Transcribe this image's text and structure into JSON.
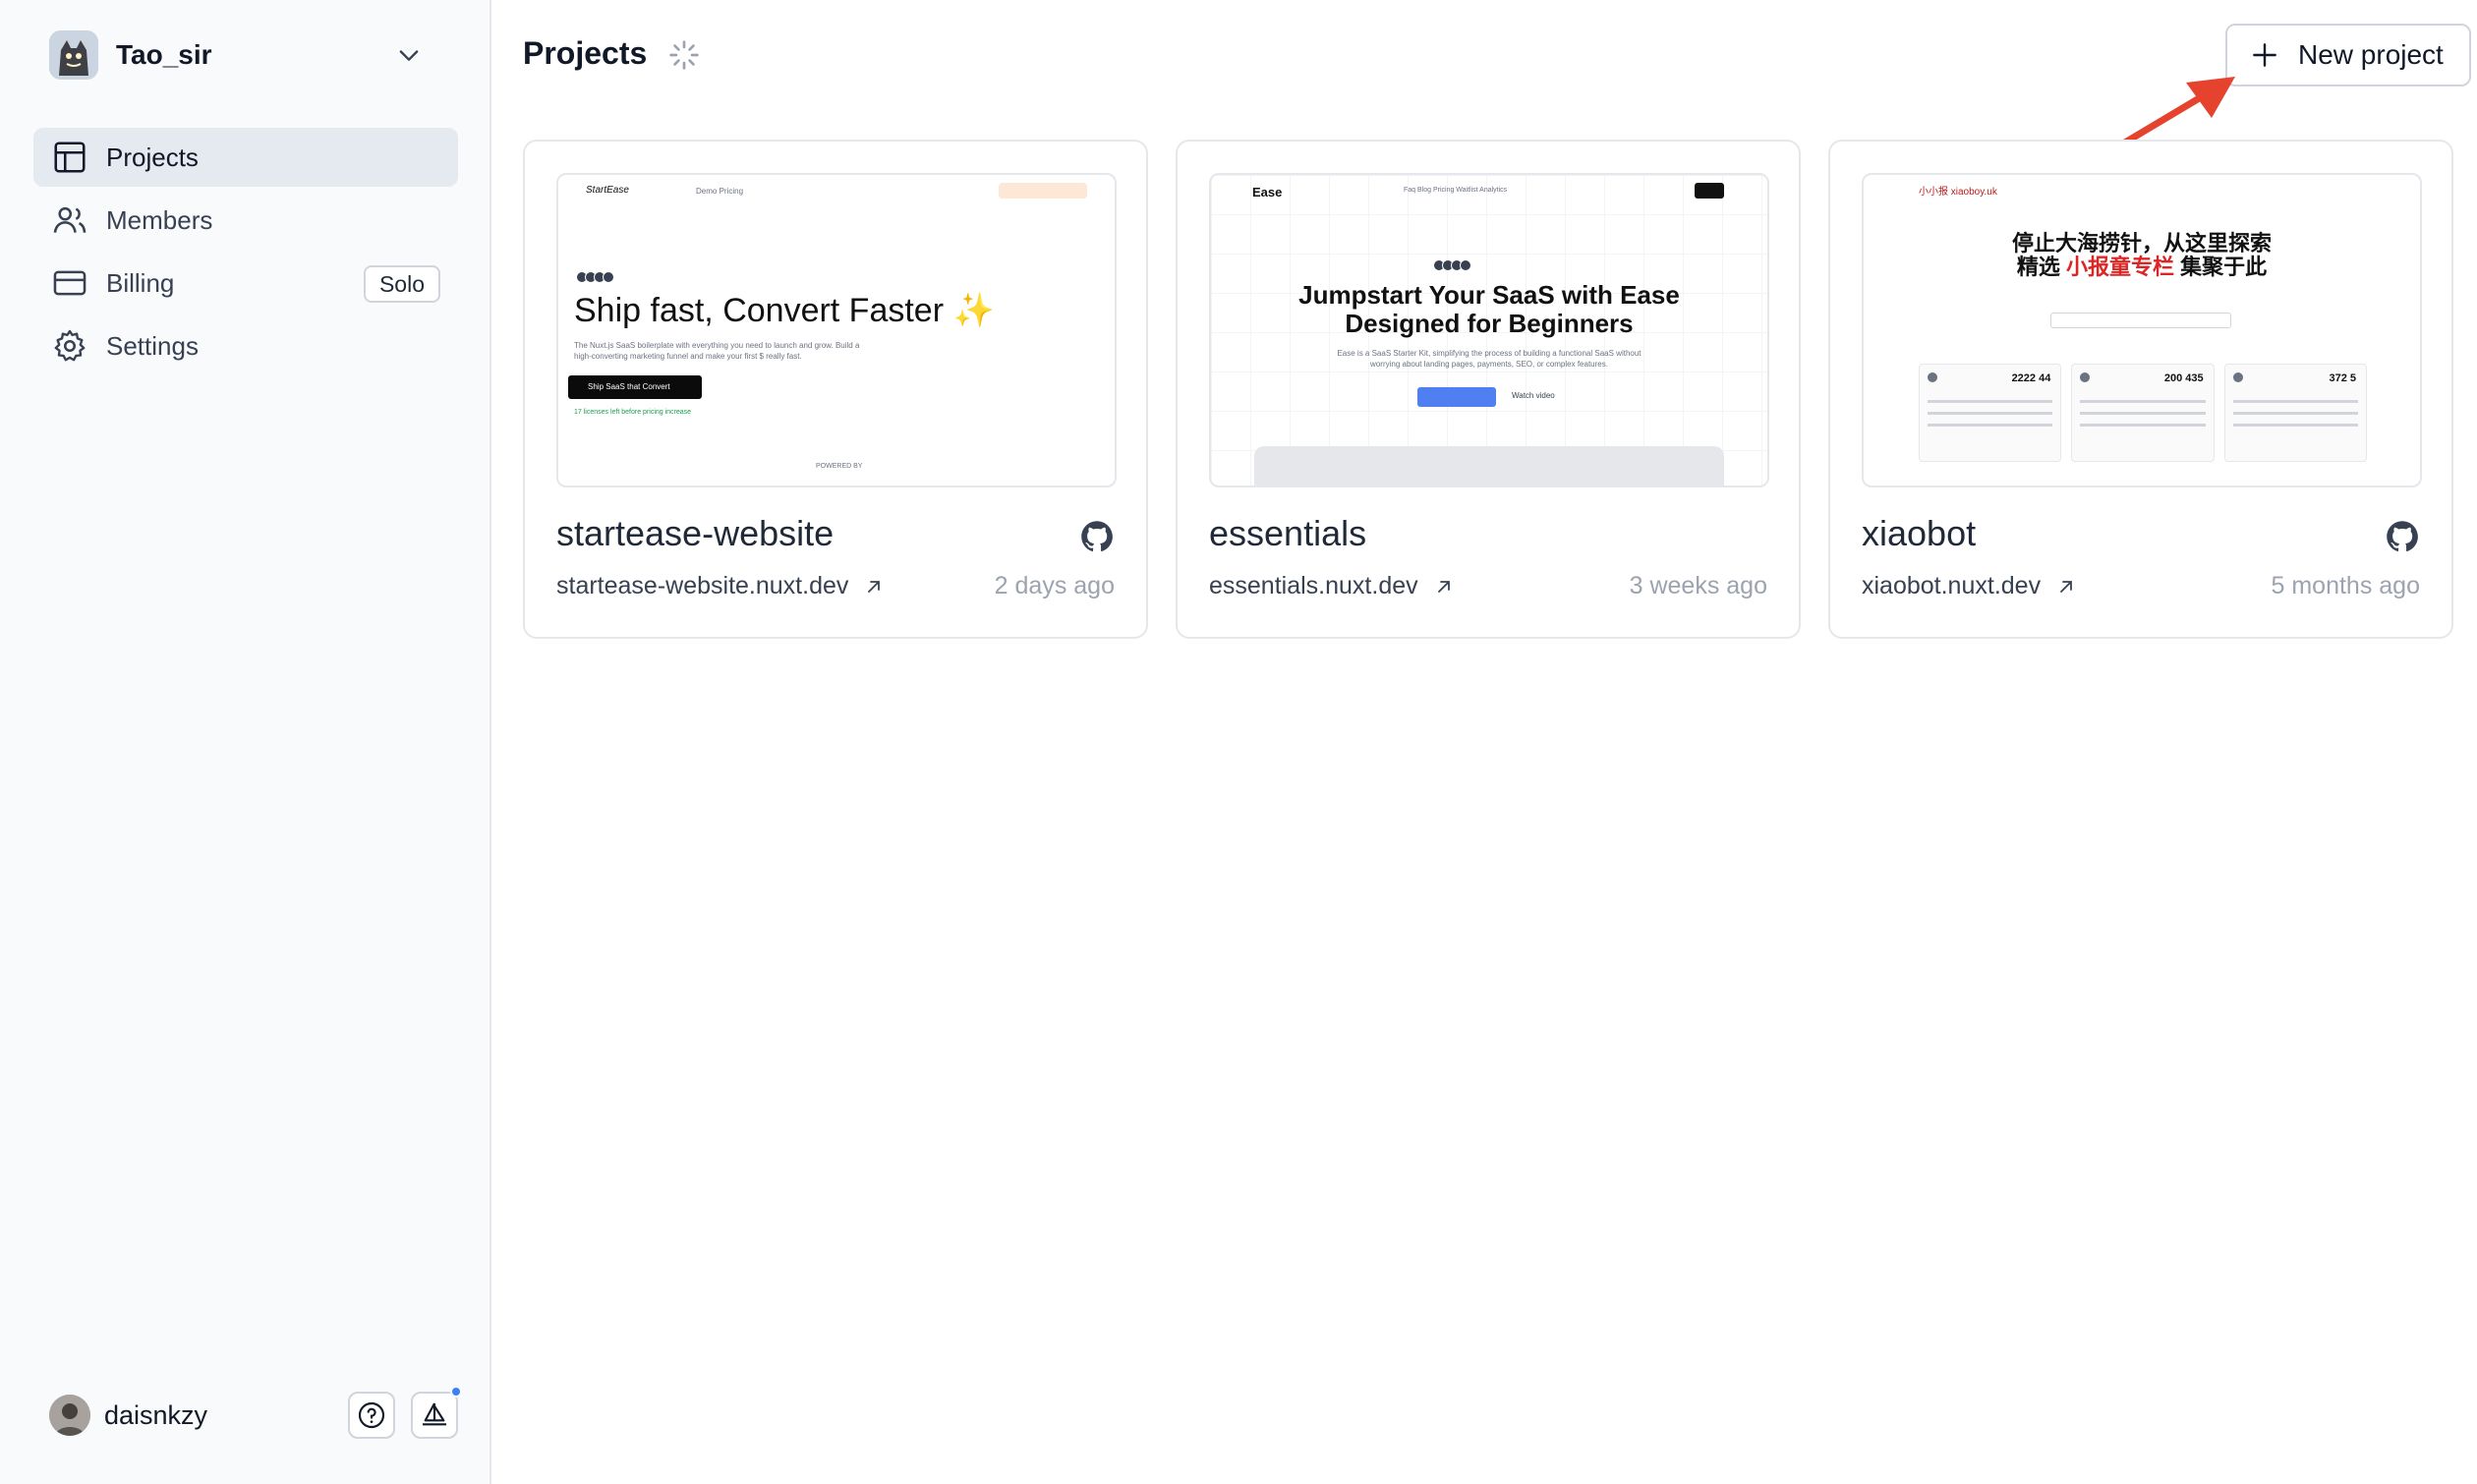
{
  "team": {
    "name": "Tao_sir"
  },
  "nav": {
    "items": [
      {
        "label": "Projects",
        "active": true,
        "icon": "layout-icon"
      },
      {
        "label": "Members",
        "active": false,
        "icon": "users-icon"
      },
      {
        "label": "Billing",
        "active": false,
        "icon": "credit-card-icon",
        "badge": "Solo"
      },
      {
        "label": "Settings",
        "active": false,
        "icon": "gear-icon"
      }
    ]
  },
  "user": {
    "name": "daisnkzy"
  },
  "main": {
    "title": "Projects",
    "new_button": "New project"
  },
  "projects": [
    {
      "name": "startease-website",
      "url": "startease-website.nuxt.dev",
      "updated": "2 days ago",
      "has_github": true,
      "preview": {
        "logo": "StartEase",
        "nav": "Demo  Pricing",
        "headline": "Ship fast, Convert Faster",
        "sub": "The Nuxt.js SaaS boilerplate with everything you need to launch and grow. Build a high-converting marketing funnel and make your first $ really fast.",
        "cta": "Ship SaaS that Convert",
        "note": "17 licenses left before pricing increase",
        "footer": "POWERED BY"
      }
    },
    {
      "name": "essentials",
      "url": "essentials.nuxt.dev",
      "updated": "3 weeks ago",
      "has_github": false,
      "preview": {
        "logo": "Ease",
        "nav": "Faq   Blog   Pricing   Waitlist   Analytics",
        "headline_1": "Jumpstart Your SaaS with Ease",
        "headline_2": "Designed for Beginners",
        "sub": "Ease is a SaaS Starter Kit, simplifying the process of building a functional SaaS without worrying about landing pages, payments, SEO, or complex features.",
        "watch": "Watch video"
      }
    },
    {
      "name": "xiaobot",
      "url": "xiaobot.nuxt.dev",
      "updated": "5 months ago",
      "has_github": true,
      "preview": {
        "logo": "小小报 xiaoboy.uk",
        "headline_1": "停止大海捞针，从这里探索",
        "headline_2_pre": "精选 ",
        "headline_2_hl": "小报童专栏",
        "headline_2_post": " 集聚于此",
        "stats": [
          "2222 44",
          "200 435",
          "372 5"
        ]
      }
    }
  ],
  "colors": {
    "accent_blue": "#3b82f6",
    "annotation_arrow": "#e5432d",
    "sidebar_bg": "#f8fafc",
    "active_nav_bg": "#e5e9f0"
  }
}
